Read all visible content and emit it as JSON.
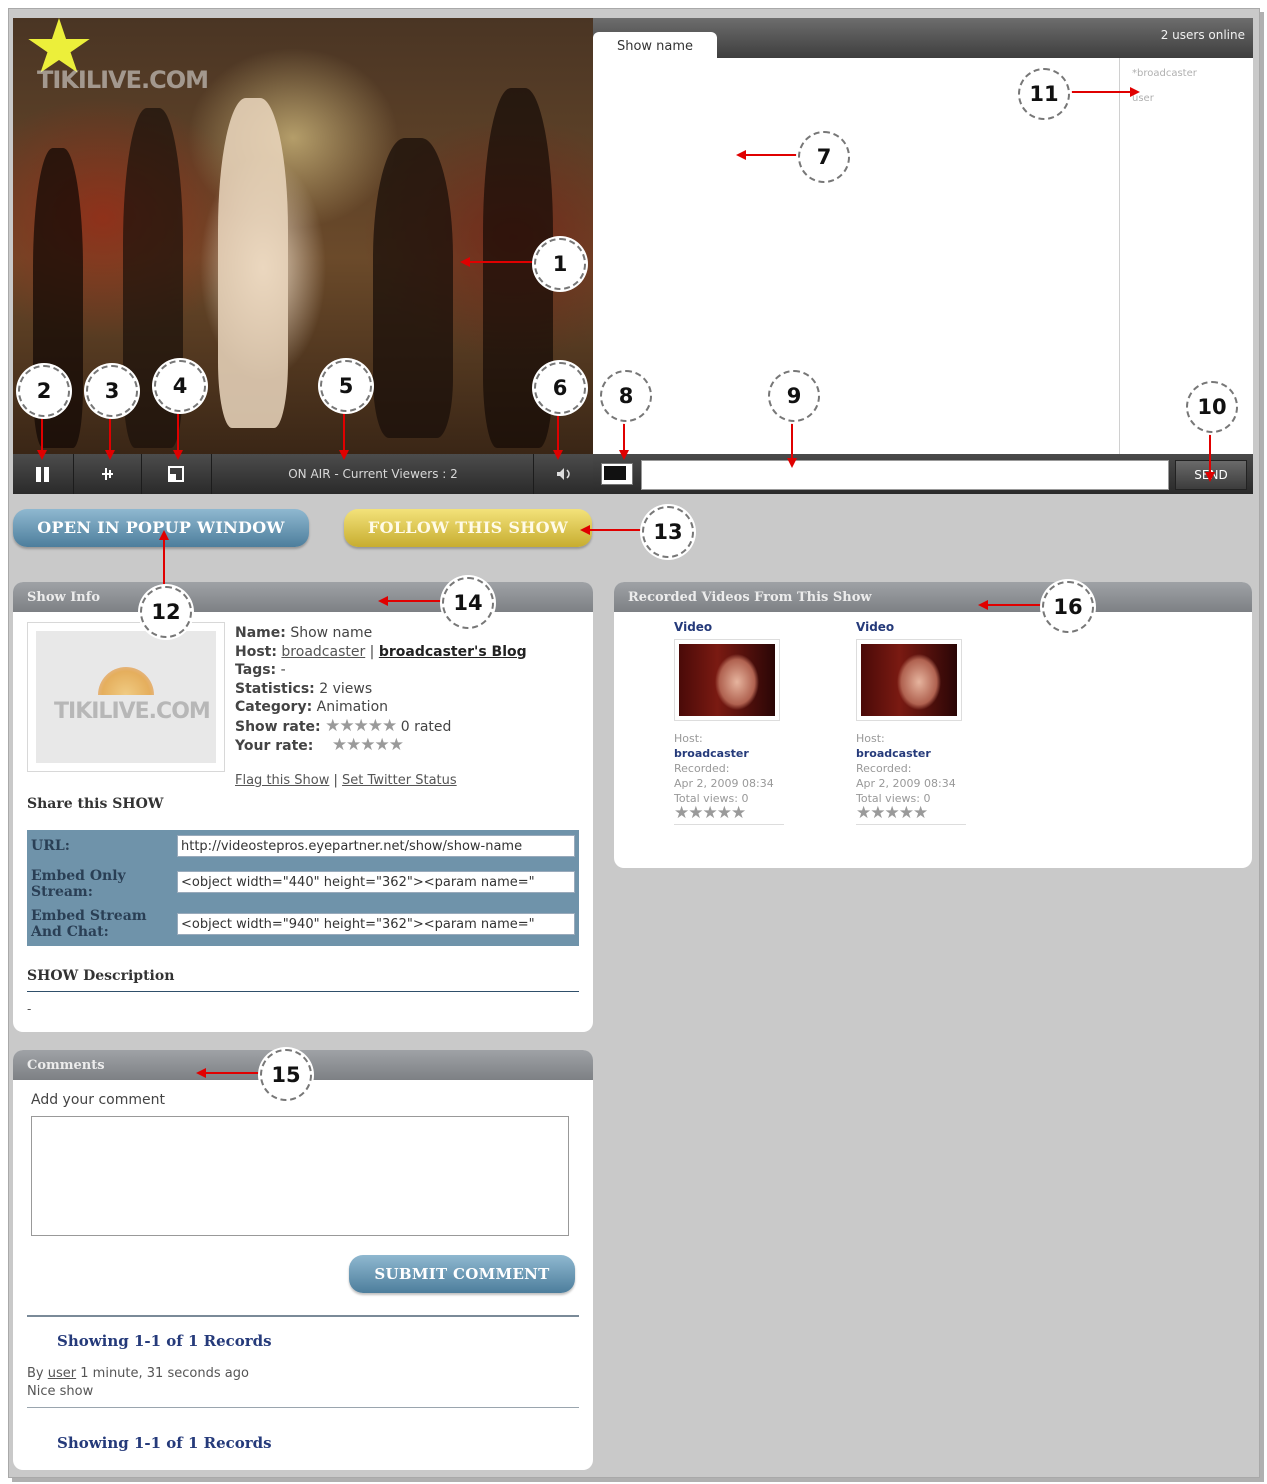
{
  "video": {
    "logo": "TIKILIVE.COM",
    "status": "ON AIR - Current Viewers : 2"
  },
  "chat": {
    "tab": "Show name",
    "online": "2 users online",
    "users": [
      "*broadcaster",
      "user"
    ],
    "send_label": "SEND"
  },
  "buttons": {
    "popup": "OPEN IN POPUP WINDOW",
    "follow": "FOLLOW THIS SHOW",
    "submit": "SUBMIT COMMENT"
  },
  "show_info": {
    "header": "Show Info",
    "thumb_logo": "TIKILIVE.COM",
    "name_label": "Name:",
    "name": "Show name",
    "host_label": "Host:",
    "host": "broadcaster",
    "sep": "|",
    "blog": "broadcaster's Blog",
    "tags_label": "Tags:",
    "tags": "-",
    "stats_label": "Statistics:",
    "stats": "2 views",
    "category_label": "Category:",
    "category": "Animation",
    "show_rate_label": "Show rate:",
    "stars": "★★★★★",
    "rated": "0 rated",
    "your_rate_label": "Your rate:",
    "flag": "Flag this Show",
    "twitter": "Set Twitter Status",
    "share_title": "Share this SHOW",
    "url_label": "URL:",
    "url": "http://videostepros.eyepartner.net/show/show-name",
    "embed_stream_label": "Embed Only Stream:",
    "embed_stream": "<object width=\"440\" height=\"362\"><param name=\"",
    "embed_chat_label": "Embed Stream And Chat:",
    "embed_chat": "<object width=\"940\" height=\"362\"><param name=\"",
    "desc_title": "SHOW Description",
    "desc": "-"
  },
  "recorded": {
    "header": "Recorded Videos From This Show",
    "items": [
      {
        "title": "Video",
        "host_label": "Host:",
        "host": "broadcaster",
        "rec_label": "Recorded:",
        "date": "Apr 2, 2009 08:34",
        "views": "Total views: 0",
        "stars": "★★★★★"
      },
      {
        "title": "Video",
        "host_label": "Host:",
        "host": "broadcaster",
        "rec_label": "Recorded:",
        "date": "Apr 2, 2009 08:34",
        "views": "Total views: 0",
        "stars": "★★★★★"
      }
    ]
  },
  "comments": {
    "header": "Comments",
    "add_label": "Add your comment",
    "records": "Showing 1-1 of 1 Records",
    "by": "By",
    "author": "user",
    "time": "1 minute, 31 seconds ago",
    "text": "Nice show"
  },
  "callouts": [
    "1",
    "2",
    "3",
    "4",
    "5",
    "6",
    "7",
    "8",
    "9",
    "10",
    "11",
    "12",
    "13",
    "14",
    "15",
    "16"
  ],
  "colors": {
    "arrow": "#e00000",
    "panel_head": "#8a8d91",
    "accent": "#253a7a"
  }
}
